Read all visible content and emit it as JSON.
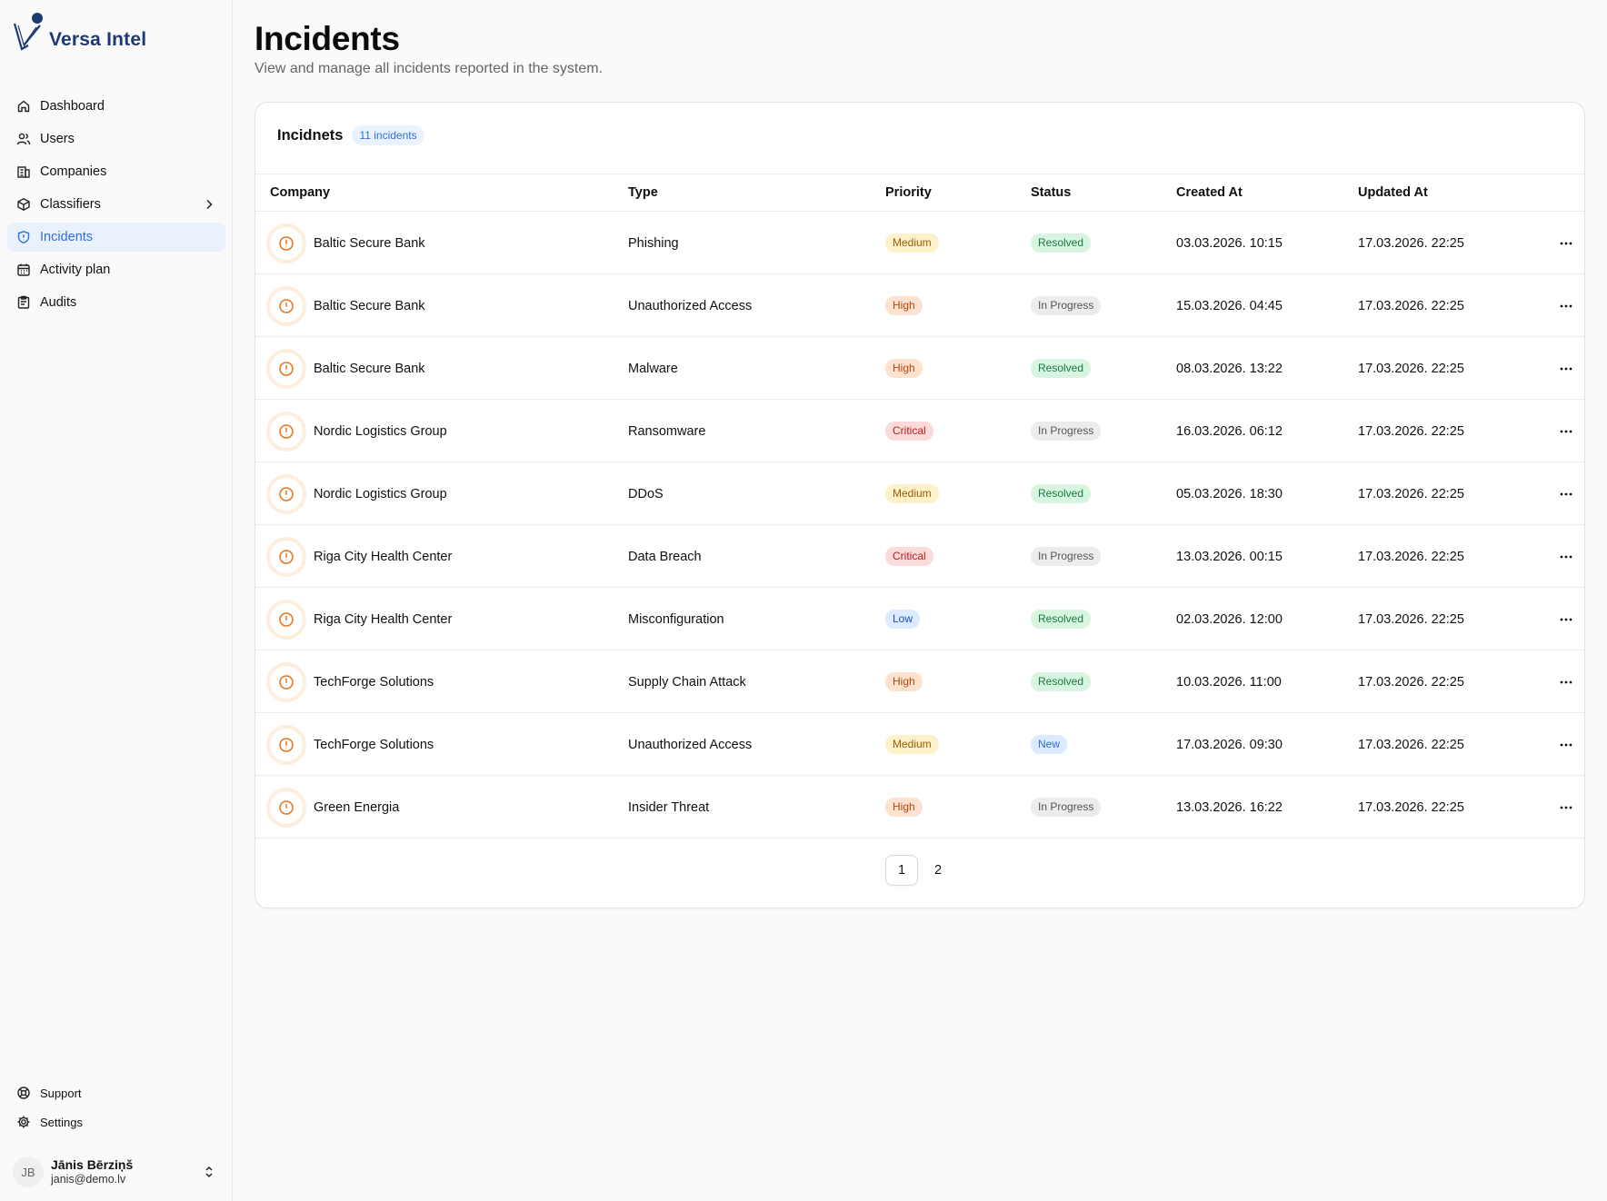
{
  "brand": {
    "name": "Versa Intel"
  },
  "sidebar": {
    "items": [
      {
        "label": "Dashboard",
        "icon": "home-icon"
      },
      {
        "label": "Users",
        "icon": "users-icon"
      },
      {
        "label": "Companies",
        "icon": "building-icon"
      },
      {
        "label": "Classifiers",
        "icon": "box-icon"
      },
      {
        "label": "Incidents",
        "icon": "shield-icon",
        "active": true
      },
      {
        "label": "Activity plan",
        "icon": "calendar-icon"
      },
      {
        "label": "Audits",
        "icon": "clipboard-icon"
      }
    ],
    "bottom": [
      {
        "label": "Support",
        "icon": "lifebuoy-icon"
      },
      {
        "label": "Settings",
        "icon": "gear-icon"
      }
    ],
    "user": {
      "initials": "JB",
      "name": "Jānis Bērziņš",
      "email": "janis@demo.lv"
    }
  },
  "page": {
    "title": "Incidents",
    "subtitle": "View and manage all incidents reported in the system."
  },
  "card": {
    "title": "Incidnets",
    "count_label": "11 incidents"
  },
  "table": {
    "headers": {
      "company": "Company",
      "type": "Type",
      "priority": "Priority",
      "status": "Status",
      "created": "Created At",
      "updated": "Updated At"
    },
    "rows": [
      {
        "company": "Baltic Secure Bank",
        "type": "Phishing",
        "priority": "Medium",
        "status": "Resolved",
        "created": "03.03.2026. 10:15",
        "updated": "17.03.2026. 22:25"
      },
      {
        "company": "Baltic Secure Bank",
        "type": "Unauthorized Access",
        "priority": "High",
        "status": "In Progress",
        "created": "15.03.2026. 04:45",
        "updated": "17.03.2026. 22:25"
      },
      {
        "company": "Baltic Secure Bank",
        "type": "Malware",
        "priority": "High",
        "status": "Resolved",
        "created": "08.03.2026. 13:22",
        "updated": "17.03.2026. 22:25"
      },
      {
        "company": "Nordic Logistics Group",
        "type": "Ransomware",
        "priority": "Critical",
        "status": "In Progress",
        "created": "16.03.2026. 06:12",
        "updated": "17.03.2026. 22:25"
      },
      {
        "company": "Nordic Logistics Group",
        "type": "DDoS",
        "priority": "Medium",
        "status": "Resolved",
        "created": "05.03.2026. 18:30",
        "updated": "17.03.2026. 22:25"
      },
      {
        "company": "Riga City Health Center",
        "type": "Data Breach",
        "priority": "Critical",
        "status": "In Progress",
        "created": "13.03.2026. 00:15",
        "updated": "17.03.2026. 22:25"
      },
      {
        "company": "Riga City Health Center",
        "type": "Misconfiguration",
        "priority": "Low",
        "status": "Resolved",
        "created": "02.03.2026. 12:00",
        "updated": "17.03.2026. 22:25"
      },
      {
        "company": "TechForge Solutions",
        "type": "Supply Chain Attack",
        "priority": "High",
        "status": "Resolved",
        "created": "10.03.2026. 11:00",
        "updated": "17.03.2026. 22:25"
      },
      {
        "company": "TechForge Solutions",
        "type": "Unauthorized Access",
        "priority": "Medium",
        "status": "New",
        "created": "17.03.2026. 09:30",
        "updated": "17.03.2026. 22:25"
      },
      {
        "company": "Green Energia",
        "type": "Insider Threat",
        "priority": "High",
        "status": "In Progress",
        "created": "13.03.2026. 16:22",
        "updated": "17.03.2026. 22:25"
      }
    ]
  },
  "pagination": {
    "pages": [
      "1",
      "2"
    ],
    "current": "1"
  },
  "colors": {
    "accent": "#2f6fe0",
    "brand": "#1e3a72",
    "incident_icon": "#e8731c"
  }
}
